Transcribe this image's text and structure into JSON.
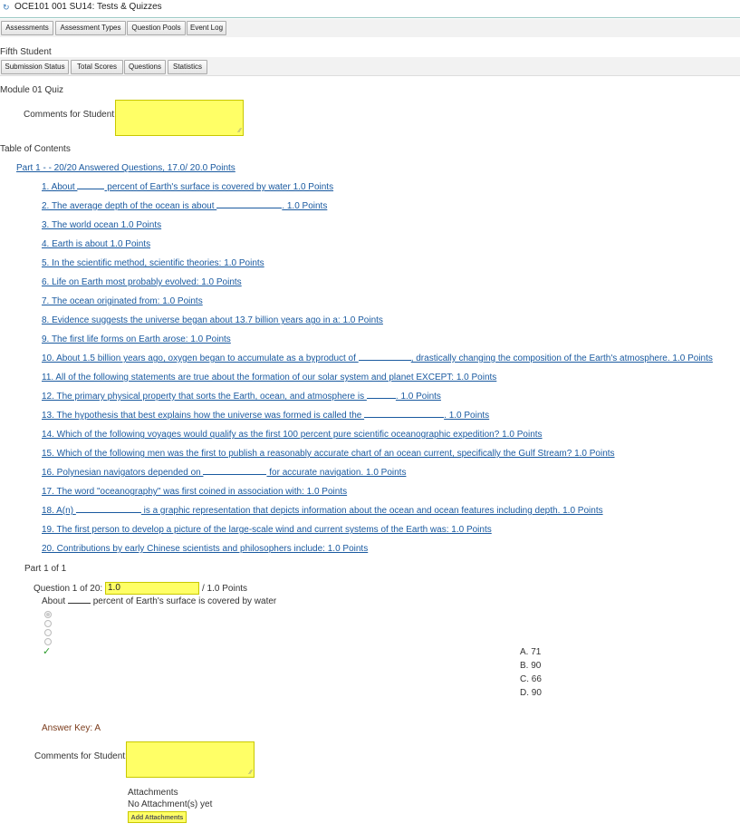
{
  "header": {
    "title": "OCE101 001 SU14: Tests & Quizzes"
  },
  "toolbar": {
    "buttons": [
      "Assessments",
      "Assessment Types",
      "Question Pools",
      "Event Log"
    ]
  },
  "student": {
    "name": "Fifth Student"
  },
  "student_toolbar": {
    "buttons": [
      "Submission Status",
      "Total Scores",
      "Questions",
      "Statistics"
    ]
  },
  "quiz": {
    "title": "Module 01 Quiz",
    "comments_label": "Comments for Student:"
  },
  "toc": {
    "heading": "Table of Contents",
    "part_link": "Part 1 - - 20/20 Answered Questions, 17.0/ 20.0 Points",
    "questions": [
      {
        "a": "1. About ",
        "b": " percent of Earth's surface is covered by water 1.0 Points",
        "blank": 30
      },
      {
        "a": "2. The average depth of the ocean is about ",
        "b": ". 1.0 Points",
        "blank": 72
      },
      {
        "a": "3. The world ocean 1.0 Points"
      },
      {
        "a": "4. Earth is about 1.0 Points"
      },
      {
        "a": "5. In the scientific method, scientific theories: 1.0 Points"
      },
      {
        "a": "6. Life on Earth most probably evolved: 1.0 Points"
      },
      {
        "a": "7. The ocean originated from: 1.0 Points"
      },
      {
        "a": "8. Evidence suggests the universe began about 13.7 billion years ago in a: 1.0 Points"
      },
      {
        "a": "9. The first life forms on Earth arose: 1.0 Points"
      },
      {
        "a": "10. About 1.5 billion years ago, oxygen began to accumulate as a byproduct of ",
        "b": ", drastically changing the composition of the Earth's atmosphere. 1.0 Points",
        "blank": 58
      },
      {
        "a": "11. All of the following statements are true about the formation of our solar system and planet EXCEPT: 1.0 Points"
      },
      {
        "a": "12. The primary physical property that sorts the Earth, ocean, and atmosphere is ",
        "b": ". 1.0 Points",
        "blank": 32
      },
      {
        "a": "13. The hypothesis that best explains how the universe was formed is called the ",
        "b": ". 1.0 Points",
        "blank": 88
      },
      {
        "a": "14. Which of the following voyages would qualify as the first 100 percent pure scientific oceanographic expedition? 1.0 Points"
      },
      {
        "a": "15. Which of the following men was the first to publish a reasonably accurate chart of an ocean current, specifically the Gulf Stream? 1.0 Points"
      },
      {
        "a": "16. Polynesian navigators depended on ",
        "b": " for accurate navigation. 1.0 Points",
        "blank": 70
      },
      {
        "a": "17. The word \"oceanography\" was first coined in association with: 1.0 Points"
      },
      {
        "a": "18. A(n) ",
        "b": " is a graphic representation that depicts information about the ocean and ocean features including depth. 1.0 Points",
        "blank": 72
      },
      {
        "a": "19. The first person to develop a picture of the large-scale wind and current systems of the Earth was: 1.0 Points"
      },
      {
        "a": "20. Contributions by early Chinese scientists and philosophers include: 1.0 Points"
      }
    ]
  },
  "part": {
    "label": "Part 1 of 1"
  },
  "question": {
    "label": "Question 1 of 20:",
    "score": "1.0",
    "max": "/ 1.0 Points",
    "text_a": "About ",
    "text_b": " percent of Earth's surface is covered by water",
    "answers": [
      "A. 71",
      "B. 90",
      "C. 66",
      "D. 90"
    ],
    "answer_key": "Answer Key: A",
    "comments_label": "Comments for Student:",
    "attachments_label": "Attachments",
    "no_attachments": "No Attachment(s) yet",
    "add_attachments": "Add Attachments"
  }
}
